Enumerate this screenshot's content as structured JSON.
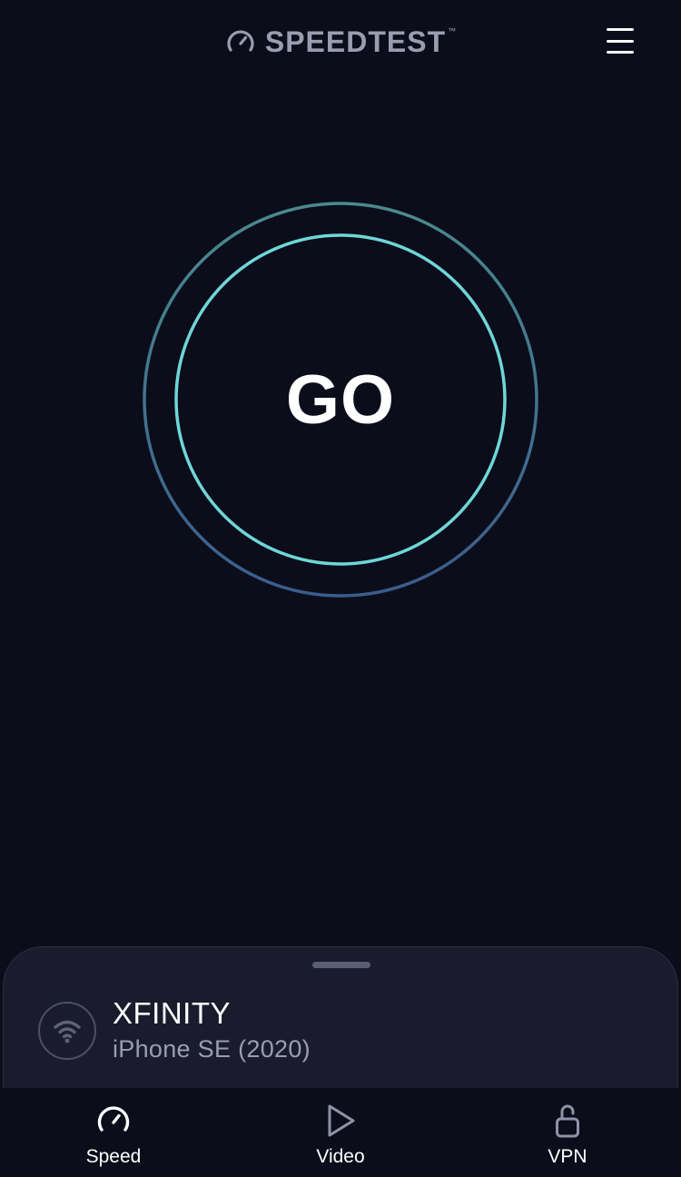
{
  "header": {
    "brand": "SPEEDTEST",
    "trademark": "™",
    "brand_icon": "speedometer-icon",
    "menu_icon": "hamburger-menu-icon"
  },
  "go_button": {
    "label": "GO"
  },
  "connection": {
    "icon": "wifi-icon",
    "provider": "XFINITY",
    "device": "iPhone SE (2020)"
  },
  "tabs": [
    {
      "label": "Speed",
      "icon": "speedometer-icon",
      "active": true
    },
    {
      "label": "Video",
      "icon": "play-icon",
      "active": false
    },
    {
      "label": "VPN",
      "icon": "unlock-icon",
      "active": false
    }
  ],
  "colors": {
    "background": "#0b0d1a",
    "sheet": "#1a1c2e",
    "brand_text": "#9a9db0",
    "inner_ring": "#6fd6d9",
    "outer_ring_top": "#4a8a8e",
    "outer_ring_bottom": "#3a5c8e"
  }
}
